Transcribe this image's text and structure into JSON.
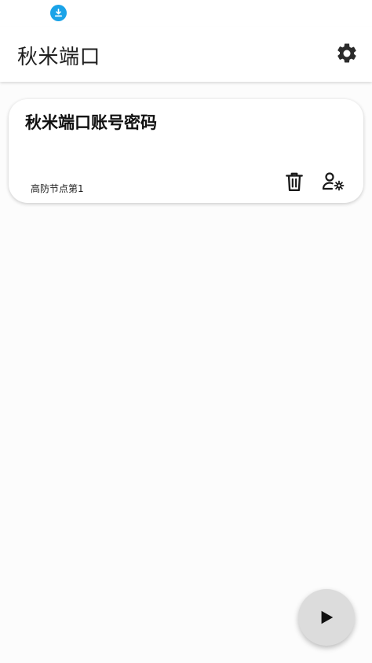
{
  "app": {
    "title": "秋米端口"
  },
  "status_bar": {
    "notification_icon": "download-icon",
    "notification_color": "#1aa3e8"
  },
  "toolbar": {
    "settings_icon": "gear-icon"
  },
  "items": [
    {
      "title": "秋米端口账号密码",
      "subtitle": "高防节点第1",
      "actions": [
        "trash-icon",
        "user-settings-icon"
      ]
    }
  ],
  "fab": {
    "icon": "play-icon",
    "color": "#dcdcdc"
  }
}
